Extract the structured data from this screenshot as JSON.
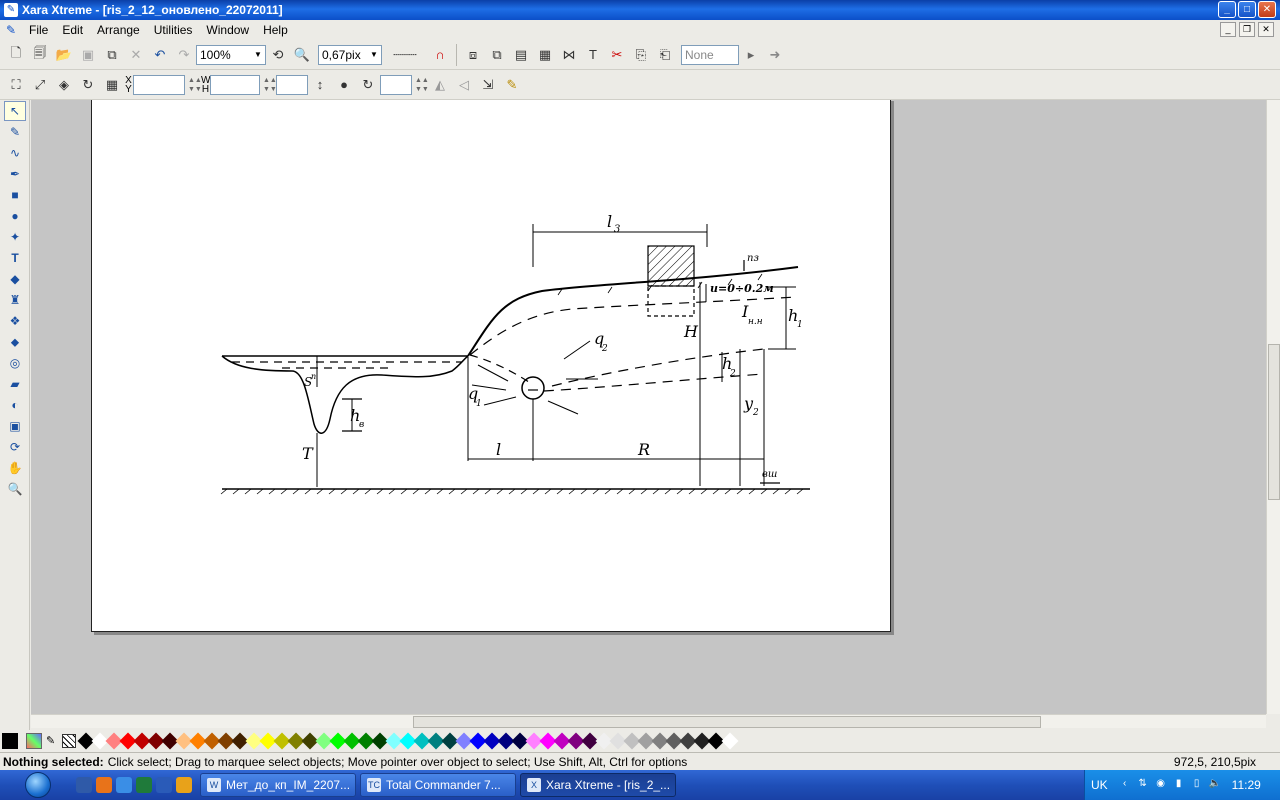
{
  "window": {
    "title": "Xara Xtreme - [ris_2_12_оновлено_22072011]",
    "buttons": {
      "minimize": "_",
      "maximize": "□",
      "close": "✕"
    }
  },
  "menu": {
    "items": [
      "File",
      "Edit",
      "Arrange",
      "Utilities",
      "Window",
      "Help"
    ]
  },
  "toolbar1": {
    "zoom_value": "100%",
    "line_width_value": "0,67pix",
    "fill_none_value": "None"
  },
  "toolbar2": {
    "x_label": "X",
    "y_label": "Y",
    "w_label": "W",
    "h_label": "H"
  },
  "drawing": {
    "l3": "l",
    "l3_sub": "3",
    "pz": "пз",
    "u_label": "u=0÷0.2м",
    "I_label": "I",
    "I_sub": "н.н",
    "h1": "h",
    "h1_sub": "1",
    "H": "H",
    "q2": "q",
    "q2_sub": "2",
    "h2": "h",
    "h2_sub": "2",
    "S_label": "S",
    "S_sub": "п",
    "q1": "q",
    "q1_sub": "1",
    "y2": "y",
    "y2_sub": "2",
    "hv": "h",
    "hv_sub": "в",
    "T": "T",
    "l": "l",
    "R": "R",
    "vsh": "вш"
  },
  "statusbar": {
    "bold": "Nothing selected:",
    "text": "Click select; Drag to marquee select objects; Move pointer over object to select; Use Shift, Alt, Ctrl for options",
    "coords": "972,5, 210,5pix"
  },
  "taskbar": {
    "tasks": [
      {
        "label": "Мет_до_кп_IM_2207...",
        "icon": "W"
      },
      {
        "label": "Total Commander 7...",
        "icon": "TC"
      },
      {
        "label": "Xara Xtreme - [ris_2_...",
        "icon": "X"
      }
    ],
    "lang": "UK",
    "clock": "11:29"
  },
  "colors": {
    "accent": "#1e6ee6",
    "palette": [
      "#000000",
      "#ffffff",
      "#ff8080",
      "#ff0000",
      "#c00000",
      "#800000",
      "#400000",
      "#ffc080",
      "#ff8000",
      "#c06000",
      "#804000",
      "#402000",
      "#ffff80",
      "#ffff00",
      "#c0c000",
      "#808000",
      "#404000",
      "#80ff80",
      "#00ff00",
      "#00c000",
      "#008000",
      "#004000",
      "#80ffff",
      "#00ffff",
      "#00c0c0",
      "#008080",
      "#004040",
      "#8080ff",
      "#0000ff",
      "#0000c0",
      "#000080",
      "#000040",
      "#ff80ff",
      "#ff00ff",
      "#c000c0",
      "#800080",
      "#400040",
      "#f0f0f0",
      "#e0e0e0",
      "#c0c0c0",
      "#a0a0a0",
      "#808080",
      "#606060",
      "#404040",
      "#202020",
      "#000000",
      "#ffffff"
    ]
  }
}
